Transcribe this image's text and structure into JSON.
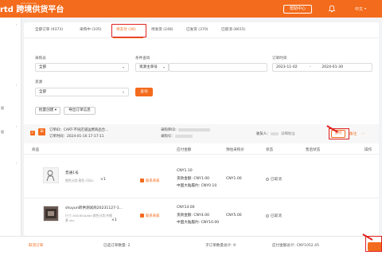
{
  "header": {
    "brand": "rtd 跨境供货平台",
    "brand_sub": "scm.rrtd.com",
    "help_label": "帮助中心",
    "lang_label": "中文",
    "bell_icon": "bell-icon"
  },
  "sidebar": {
    "items": [
      {
        "label": "",
        "caret": "›"
      },
      {
        "label": "理",
        "caret": "›"
      },
      {
        "label": "理",
        "caret": "›"
      },
      {
        "label": "",
        "caret": "›"
      }
    ]
  },
  "tabs": [
    {
      "label": "全部订单 (9373)",
      "active": false
    },
    {
      "label": "采购中 (105)",
      "active": false
    },
    {
      "label": "待支付 (36)",
      "active": true
    },
    {
      "label": "待发货 (248)",
      "active": false
    },
    {
      "label": "已发货 (370)",
      "active": false
    },
    {
      "label": "已取消 (8615)",
      "active": false
    }
  ],
  "filters": {
    "buyer_label": "采购员",
    "buyer_value": "全部",
    "condition_label": "条件查询",
    "condition_select": "资源主单号",
    "condition_input_placeholder": "",
    "time_label": "订单时间",
    "time_start": "2023-11-02",
    "time_sep": "-",
    "time_end": "2024-01-30",
    "source_label": "货源",
    "source_value": "全部",
    "search_label": "查询"
  },
  "actions": {
    "batch_create_label": "批量创建",
    "export_label": "导出订单信息"
  },
  "order": {
    "order_id_label": "订单ID：",
    "order_id_value": "CART-不同店铺运费商品合...",
    "order_time_label": "订单时间：",
    "order_time_value": "2024-01-16 17:17:11",
    "purchase_id_label": "采购单ID：",
    "purchase_seller_label": "采购号：",
    "receiver_label": "收货人：",
    "address_link": "详细地址",
    "pay_label": "支付",
    "remark_label": "备注",
    "more_label": "..."
  },
  "table": {
    "columns": [
      "商品",
      "应付金额",
      "预估采购价",
      "状态",
      "售后状态",
      "操作"
    ]
  },
  "products": [
    {
      "name": "普通1号",
      "spec": "颜色分类:黄色 尺码:L",
      "qty": "×1",
      "seller": "联系商家",
      "amount_total": "CNY1.10",
      "amount_goods": "货款金额: CNY1.00",
      "amount_ship": "中国大陆履约: CNY0.10",
      "estimate": "CNY1.00",
      "status": "已取消"
    },
    {
      "name": "shuyun跨供测试商20231127-1...",
      "spec": "尺寸:160(80)Addd 颜色分类:柠檬黄 sku",
      "qty": "×1",
      "seller": "联系商家",
      "amount_total": "CNY14.00",
      "amount_goods": "货款金额: CNY4.00",
      "amount_ship": "中国大陆履约: CNY10.00",
      "estimate": "CNY5.00",
      "status": "已取消"
    }
  ],
  "footer": {
    "cancel_label": "取消订单",
    "selected_label": "已选订单数量: 2",
    "sub_count_label": "子订单数量总计: 9",
    "payable_label": "应付金额总计: CNY1052.45"
  },
  "colors": {
    "brand": "#f36b1c",
    "annotation": "#e02020"
  }
}
